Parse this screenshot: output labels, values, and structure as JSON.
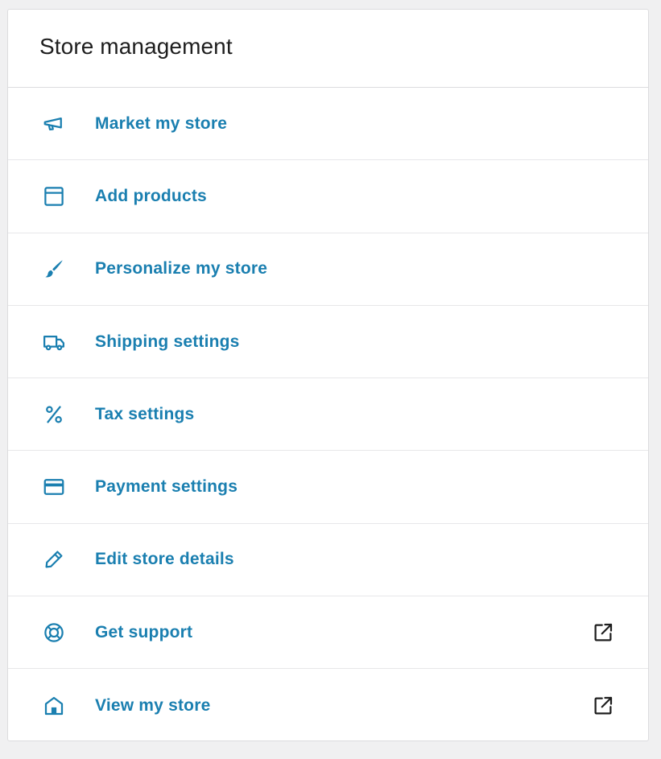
{
  "card": {
    "title": "Store management"
  },
  "items": [
    {
      "label": "Market my store",
      "icon": "megaphone-icon",
      "external": false
    },
    {
      "label": "Add products",
      "icon": "archive-box-icon",
      "external": false
    },
    {
      "label": "Personalize my store",
      "icon": "brush-icon",
      "external": false
    },
    {
      "label": "Shipping settings",
      "icon": "truck-icon",
      "external": false
    },
    {
      "label": "Tax settings",
      "icon": "percent-icon",
      "external": false
    },
    {
      "label": "Payment settings",
      "icon": "credit-card-icon",
      "external": false
    },
    {
      "label": "Edit store details",
      "icon": "pencil-icon",
      "external": false
    },
    {
      "label": "Get support",
      "icon": "lifebuoy-icon",
      "external": true
    },
    {
      "label": "View my store",
      "icon": "store-home-icon",
      "external": true
    }
  ],
  "colors": {
    "link": "#1a7fb0",
    "icon": "#1a7fb0",
    "external_icon": "#1e1e1e",
    "title": "#1e1e1e",
    "border": "#dcdcde",
    "page_bg": "#f0f0f1",
    "card_bg": "#ffffff"
  }
}
